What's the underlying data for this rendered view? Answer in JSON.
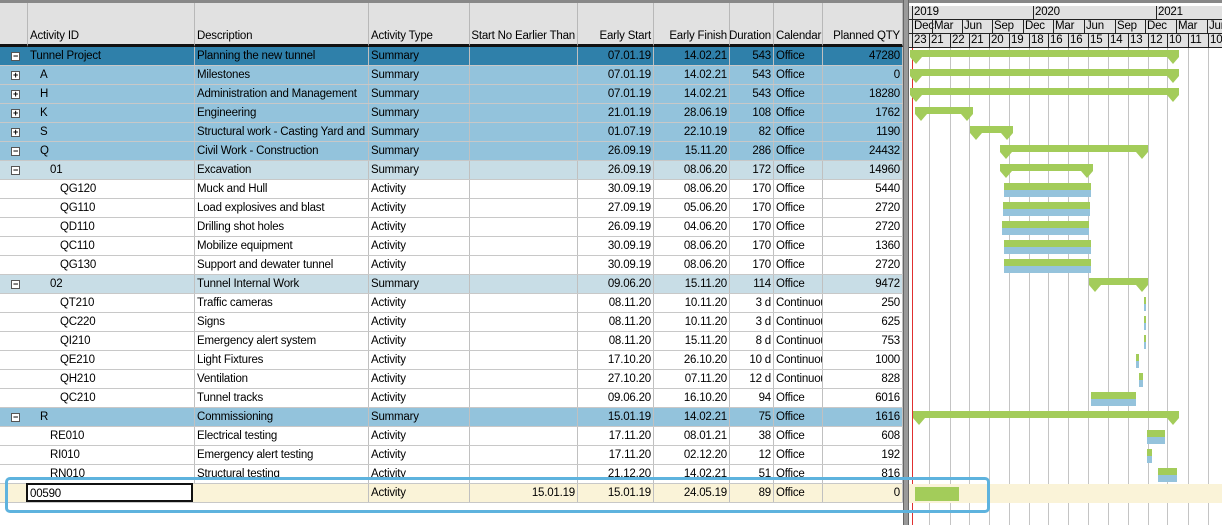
{
  "columns": [
    "Activity ID",
    "Description",
    "Activity Type",
    "Start No Earlier Than",
    "Early Start",
    "Early Finish",
    "Duration",
    "Calendar",
    "Planned QTY"
  ],
  "rows": [
    {
      "id": "Tunnel Project",
      "desc": "Planning the new tunnel",
      "type": "Summary",
      "snet": "",
      "es": "07.01.19",
      "ef": "14.02.21",
      "dur": "543",
      "cal": "Office",
      "qty": "47280",
      "level": 0,
      "kind": "project",
      "exp": "minus"
    },
    {
      "id": "A",
      "desc": "Milestones",
      "type": "Summary",
      "snet": "",
      "es": "07.01.19",
      "ef": "14.02.21",
      "dur": "543",
      "cal": "Office",
      "qty": "0",
      "level": 1,
      "kind": "wbs1",
      "exp": "plus"
    },
    {
      "id": "H",
      "desc": "Administration and Management",
      "type": "Summary",
      "snet": "",
      "es": "07.01.19",
      "ef": "14.02.21",
      "dur": "543",
      "cal": "Office",
      "qty": "18280",
      "level": 1,
      "kind": "wbs1",
      "exp": "plus"
    },
    {
      "id": "K",
      "desc": "Engineering",
      "type": "Summary",
      "snet": "",
      "es": "21.01.19",
      "ef": "28.06.19",
      "dur": "108",
      "cal": "Office",
      "qty": "1762",
      "level": 1,
      "kind": "wbs1",
      "exp": "plus"
    },
    {
      "id": "S",
      "desc": "Structural work - Casting Yard and P",
      "type": "Summary",
      "snet": "",
      "es": "01.07.19",
      "ef": "22.10.19",
      "dur": "82",
      "cal": "Office",
      "qty": "1190",
      "level": 1,
      "kind": "wbs1",
      "exp": "plus"
    },
    {
      "id": "Q",
      "desc": "Civil Work - Construction",
      "type": "Summary",
      "snet": "",
      "es": "26.09.19",
      "ef": "15.11.20",
      "dur": "286",
      "cal": "Office",
      "qty": "24432",
      "level": 1,
      "kind": "wbs1",
      "exp": "minus"
    },
    {
      "id": "01",
      "desc": "Excavation",
      "type": "Summary",
      "snet": "",
      "es": "26.09.19",
      "ef": "08.06.20",
      "dur": "172",
      "cal": "Office",
      "qty": "14960",
      "level": 2,
      "kind": "wbs2",
      "exp": "minus"
    },
    {
      "id": "QG120",
      "desc": "Muck and Hull",
      "type": "Activity",
      "snet": "",
      "es": "30.09.19",
      "ef": "08.06.20",
      "dur": "170",
      "cal": "Office",
      "qty": "5440",
      "level": 3,
      "kind": "activity",
      "exp": ""
    },
    {
      "id": "QG110",
      "desc": "Load explosives and blast",
      "type": "Activity",
      "snet": "",
      "es": "27.09.19",
      "ef": "05.06.20",
      "dur": "170",
      "cal": "Office",
      "qty": "2720",
      "level": 3,
      "kind": "activity",
      "exp": ""
    },
    {
      "id": "QD110",
      "desc": "Drilling shot holes",
      "type": "Activity",
      "snet": "",
      "es": "26.09.19",
      "ef": "04.06.20",
      "dur": "170",
      "cal": "Office",
      "qty": "2720",
      "level": 3,
      "kind": "activity",
      "exp": ""
    },
    {
      "id": "QC110",
      "desc": "Mobilize equipment",
      "type": "Activity",
      "snet": "",
      "es": "30.09.19",
      "ef": "08.06.20",
      "dur": "170",
      "cal": "Office",
      "qty": "1360",
      "level": 3,
      "kind": "activity",
      "exp": ""
    },
    {
      "id": "QG130",
      "desc": "Support and dewater tunnel",
      "type": "Activity",
      "snet": "",
      "es": "30.09.19",
      "ef": "08.06.20",
      "dur": "170",
      "cal": "Office",
      "qty": "2720",
      "level": 3,
      "kind": "activity",
      "exp": ""
    },
    {
      "id": "02",
      "desc": "Tunnel Internal Work",
      "type": "Summary",
      "snet": "",
      "es": "09.06.20",
      "ef": "15.11.20",
      "dur": "114",
      "cal": "Office",
      "qty": "9472",
      "level": 2,
      "kind": "wbs2",
      "exp": "minus"
    },
    {
      "id": "QT210",
      "desc": "Traffic cameras",
      "type": "Activity",
      "snet": "",
      "es": "08.11.20",
      "ef": "10.11.20",
      "dur": "3 d",
      "cal": "Continuous",
      "qty": "250",
      "level": 3,
      "kind": "activity",
      "exp": ""
    },
    {
      "id": "QC220",
      "desc": "Signs",
      "type": "Activity",
      "snet": "",
      "es": "08.11.20",
      "ef": "10.11.20",
      "dur": "3 d",
      "cal": "Continuous",
      "qty": "625",
      "level": 3,
      "kind": "activity",
      "exp": ""
    },
    {
      "id": "QI210",
      "desc": "Emergency alert system",
      "type": "Activity",
      "snet": "",
      "es": "08.11.20",
      "ef": "15.11.20",
      "dur": "8 d",
      "cal": "Continuous",
      "qty": "753",
      "level": 3,
      "kind": "activity",
      "exp": ""
    },
    {
      "id": "QE210",
      "desc": "Light Fixtures",
      "type": "Activity",
      "snet": "",
      "es": "17.10.20",
      "ef": "26.10.20",
      "dur": "10 d",
      "cal": "Continuous",
      "qty": "1000",
      "level": 3,
      "kind": "activity",
      "exp": ""
    },
    {
      "id": "QH210",
      "desc": "Ventilation",
      "type": "Activity",
      "snet": "",
      "es": "27.10.20",
      "ef": "07.11.20",
      "dur": "12 d",
      "cal": "Continuous",
      "qty": "828",
      "level": 3,
      "kind": "activity",
      "exp": ""
    },
    {
      "id": "QC210",
      "desc": "Tunnel tracks",
      "type": "Activity",
      "snet": "",
      "es": "09.06.20",
      "ef": "16.10.20",
      "dur": "94",
      "cal": "Office",
      "qty": "6016",
      "level": 3,
      "kind": "activity",
      "exp": ""
    },
    {
      "id": "R",
      "desc": "Commissioning",
      "type": "Summary",
      "snet": "",
      "es": "15.01.19",
      "ef": "14.02.21",
      "dur": "75",
      "cal": "Office",
      "qty": "1616",
      "level": 1,
      "kind": "wbs1",
      "exp": "minus"
    },
    {
      "id": "RE010",
      "desc": "Electrical testing",
      "type": "Activity",
      "snet": "",
      "es": "17.11.20",
      "ef": "08.01.21",
      "dur": "38",
      "cal": "Office",
      "qty": "608",
      "level": 2,
      "kind": "activity",
      "exp": ""
    },
    {
      "id": "RI010",
      "desc": "Emergency alert testing",
      "type": "Activity",
      "snet": "",
      "es": "17.11.20",
      "ef": "02.12.20",
      "dur": "12",
      "cal": "Office",
      "qty": "192",
      "level": 2,
      "kind": "activity",
      "exp": ""
    },
    {
      "id": "RN010",
      "desc": "Structural testing",
      "type": "Activity",
      "snet": "",
      "es": "21.12.20",
      "ef": "14.02.21",
      "dur": "51",
      "cal": "Office",
      "qty": "816",
      "level": 2,
      "kind": "activity",
      "exp": ""
    },
    {
      "id": "00590",
      "desc": "",
      "type": "Activity",
      "snet": "15.01.19",
      "es": "15.01.19",
      "ef": "24.05.19",
      "dur": "89",
      "cal": "Office",
      "qty": "0",
      "level": 0,
      "kind": "new",
      "exp": ""
    }
  ],
  "timescale": {
    "years": [
      "2019",
      "2020",
      "2021"
    ],
    "months": [
      "Dec",
      "Mar",
      "Jun",
      "Sep",
      "Dec",
      "Mar",
      "Jun",
      "Sep",
      "Dec",
      "Mar",
      "Jun"
    ],
    "days": [
      "23",
      "21",
      "22",
      "21",
      "20",
      "19",
      "18",
      "16",
      "16",
      "15",
      "14",
      "13",
      "12",
      "10",
      "11",
      "10"
    ]
  },
  "colors": {
    "project": "#2f80aa",
    "wbs1": "#93c3dc",
    "wbs2": "#c8dde6",
    "activity": "#ffffff",
    "new": "#faf3d8",
    "bar_green": "#a3cc5a",
    "bar_blue": "#95c3dc",
    "selection": "#5eb3de"
  }
}
